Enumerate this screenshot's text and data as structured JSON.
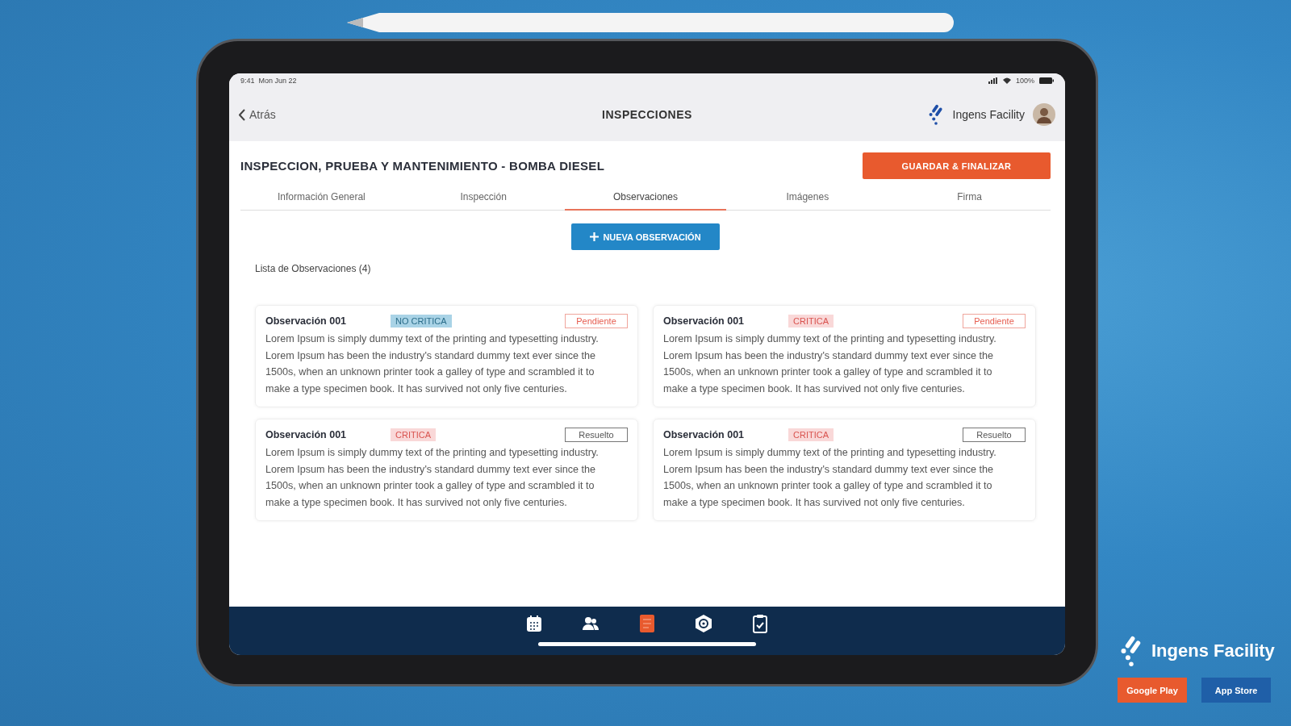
{
  "status_bar": {
    "time": "9:41",
    "date": "Mon Jun 22",
    "battery": "100%"
  },
  "header": {
    "back": "Atrás",
    "title": "INSPECCIONES",
    "brand": "Ingens Facility"
  },
  "form": {
    "title": "INSPECCION, PRUEBA Y MANTENIMIENTO - BOMBA DIESEL",
    "save_button": "GUARDAR & FINALIZAR"
  },
  "tabs": [
    {
      "label": "Información General",
      "selected": false
    },
    {
      "label": "Inspección",
      "selected": false
    },
    {
      "label": "Observaciones",
      "selected": true
    },
    {
      "label": "Imágenes",
      "selected": false
    },
    {
      "label": "Firma",
      "selected": false
    }
  ],
  "new_button": "NUEVA OBSERVACIÓN",
  "list_label": "Lista de Observaciones (4)",
  "observations": [
    {
      "title": "Observación 001",
      "severity": {
        "label": "NO CRITICA",
        "kind": "no_critica"
      },
      "status": {
        "label": "Pendiente",
        "kind": "pendiente"
      },
      "text": "Lorem Ipsum is simply dummy text of the printing and typesetting industry. Lorem Ipsum has been the industry's standard dummy text ever since the 1500s, when an unknown printer took a galley of type and scrambled it to make a type specimen book. It has survived not only five centuries."
    },
    {
      "title": "Observación 001",
      "severity": {
        "label": "CRITICA",
        "kind": "critica"
      },
      "status": {
        "label": "Pendiente",
        "kind": "pendiente"
      },
      "text": "Lorem Ipsum is simply dummy text of the printing and typesetting industry. Lorem Ipsum has been the industry's standard dummy text ever since the 1500s, when an unknown printer took a galley of type and scrambled it to make a type specimen book. It has survived not only five centuries."
    },
    {
      "title": "Observación 001",
      "severity": {
        "label": "CRITICA",
        "kind": "critica"
      },
      "status": {
        "label": "Resuelto",
        "kind": "resuelto"
      },
      "text": "Lorem Ipsum is simply dummy text of the printing and typesetting industry. Lorem Ipsum has been the industry's standard dummy text ever since the 1500s, when an unknown printer took a galley of type and scrambled it to make a type specimen book. It has survived not only five centuries."
    },
    {
      "title": "Observación 001",
      "severity": {
        "label": "CRITICA",
        "kind": "critica"
      },
      "status": {
        "label": "Resuelto",
        "kind": "resuelto"
      },
      "text": "Lorem Ipsum is simply dummy text of the printing and typesetting industry. Lorem Ipsum has been the industry's standard dummy text ever since the 1500s, when an unknown printer took a galley of type and scrambled it to make a type specimen book. It has survived not only five centuries."
    }
  ],
  "bottom_nav": [
    {
      "kind": "calendar",
      "selected": false
    },
    {
      "kind": "people",
      "selected": false
    },
    {
      "kind": "document",
      "selected": true
    },
    {
      "kind": "gear",
      "selected": false
    },
    {
      "kind": "clipboard",
      "selected": false
    }
  ],
  "promo": {
    "brand": "Ingens Facility",
    "store_buttons": [
      {
        "label": "Google Play",
        "kind": "google"
      },
      {
        "label": "App Store",
        "kind": "apple"
      }
    ]
  }
}
